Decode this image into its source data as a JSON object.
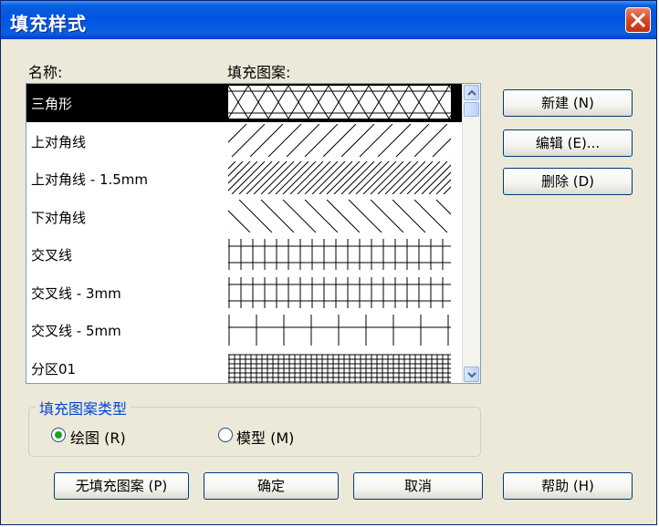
{
  "window": {
    "title": "填充样式"
  },
  "labels": {
    "name_header": "名称:",
    "pattern_header": "填充图案:"
  },
  "patterns": [
    {
      "name": "三角形",
      "pattern": "triangle",
      "selected": true
    },
    {
      "name": "上对角线",
      "pattern": "diag-up",
      "selected": false
    },
    {
      "name": "上对角线 - 1.5mm",
      "pattern": "diag-up-fine",
      "selected": false
    },
    {
      "name": "下对角线",
      "pattern": "diag-down",
      "selected": false
    },
    {
      "name": "交叉线",
      "pattern": "cross",
      "selected": false
    },
    {
      "name": "交叉线 - 3mm",
      "pattern": "cross-3mm",
      "selected": false
    },
    {
      "name": "交叉线 - 5mm",
      "pattern": "cross-5mm",
      "selected": false
    },
    {
      "name": "分区01",
      "pattern": "grid-fine",
      "selected": false
    }
  ],
  "side_buttons": {
    "new": "新建 (N)",
    "edit": "编辑 (E)...",
    "delete": "删除 (D)"
  },
  "fill_type": {
    "title": "填充图案类型",
    "drafting": "绘图 (R)",
    "model": "模型 (M)",
    "selected": "drafting"
  },
  "bottom_buttons": {
    "no_fill": "无填充图案 (P)",
    "ok": "确定",
    "cancel": "取消",
    "help": "帮助 (H)"
  },
  "icons": {
    "close": "close-icon",
    "scroll_up": "arrow-up-icon",
    "scroll_down": "arrow-down-icon"
  }
}
